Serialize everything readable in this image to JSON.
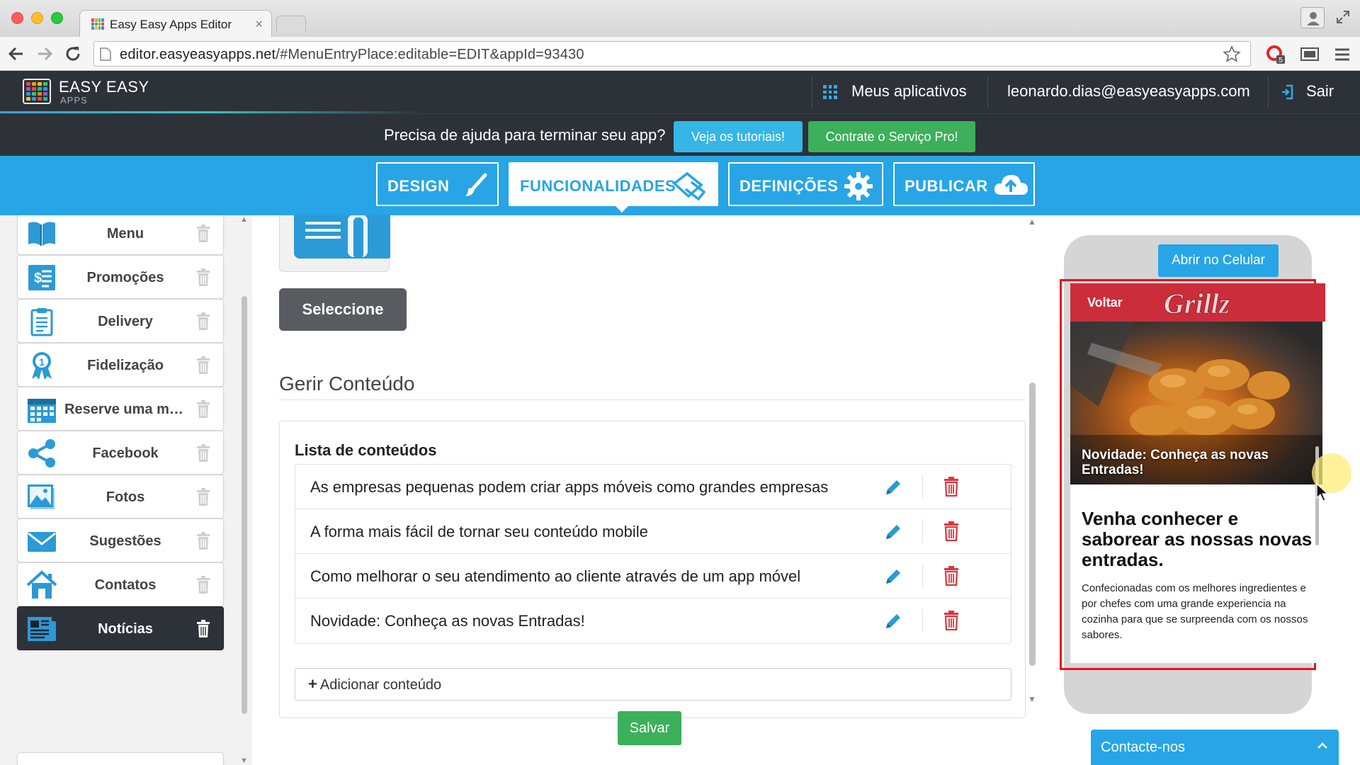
{
  "browser": {
    "tab_title": "Easy Easy Apps Editor",
    "tab_close": "×",
    "url_host": "editor.easyeasyapps.net",
    "url_path": "/#MenuEntryPlace:editable=EDIT&appId=93430",
    "opera_badge": "5"
  },
  "header": {
    "logo_main": "EASY EASY",
    "logo_sub": "APPS",
    "my_apps": "Meus aplicativos",
    "user_email": "leonardo.dias@easyeasyapps.com",
    "logout": "Sair"
  },
  "helpbar": {
    "text": "Precisa de ajuda para terminar seu app?",
    "tutorials_button": "Veja os tutoriais!",
    "pro_button": "Contrate o Serviço Pro!"
  },
  "nav": {
    "tabs": [
      {
        "label": "DESIGN",
        "icon": "brush-icon",
        "active": false
      },
      {
        "label": "FUNCIONALIDADES",
        "icon": "puzzle-icon",
        "active": true
      },
      {
        "label": "DEFINIÇÕES",
        "icon": "gear-icon",
        "active": false
      },
      {
        "label": "PUBLICAR",
        "icon": "cloud-upload-icon",
        "active": false
      }
    ]
  },
  "sidebar": {
    "items": [
      {
        "label": "Menu",
        "icon": "book-icon",
        "active": false
      },
      {
        "label": "Promoções",
        "icon": "price-tag-icon",
        "active": false
      },
      {
        "label": "Delivery",
        "icon": "clipboard-icon",
        "active": false
      },
      {
        "label": "Fidelização",
        "icon": "award-ribbon-icon",
        "active": false
      },
      {
        "label": "Reserve uma me...",
        "icon": "calendar-icon",
        "active": false
      },
      {
        "label": "Facebook",
        "icon": "share-icon",
        "active": false
      },
      {
        "label": "Fotos",
        "icon": "photo-icon",
        "active": false
      },
      {
        "label": "Sugestões",
        "icon": "envelope-icon",
        "active": false
      },
      {
        "label": "Contatos",
        "icon": "house-icon",
        "active": false
      },
      {
        "label": "Notícias",
        "icon": "newspaper-icon",
        "active": true
      }
    ]
  },
  "main": {
    "select_button": "Seleccione",
    "section_title": "Gerir Conteúdo",
    "list_title": "Lista de conteúdos",
    "items": [
      "As empresas pequenas podem criar apps móveis como grandes empresas",
      "A forma mais fácil de tornar seu conteúdo mobile",
      "Como melhorar o seu atendimento ao cliente através de um app móvel",
      "Novidade: Conheça as novas Entradas!"
    ],
    "add_plus": "+",
    "add_button": "Adicionar conteúdo",
    "save_button": "Salvar"
  },
  "preview": {
    "open_button": "Abrir no Celular",
    "back": "Voltar",
    "brand": "Grillz",
    "hero_caption": "Novidade: Conheça as novas Entradas!",
    "article_title": "Venha conhecer e saborear as nossas novas entradas.",
    "article_body": "Confecionadas com os melhores ingredientes e por chefes com uma grande experiencia na cozinha para que se surpreenda com os nossos sabores.",
    "contact": "Contacte-nos"
  },
  "colors": {
    "accent": "#27a5e6",
    "header_bg": "#2d3138",
    "success": "#3cb05a",
    "danger": "#d9363e",
    "preview_highlight": "#e3141b",
    "grillz_red": "#cc2d3a"
  }
}
